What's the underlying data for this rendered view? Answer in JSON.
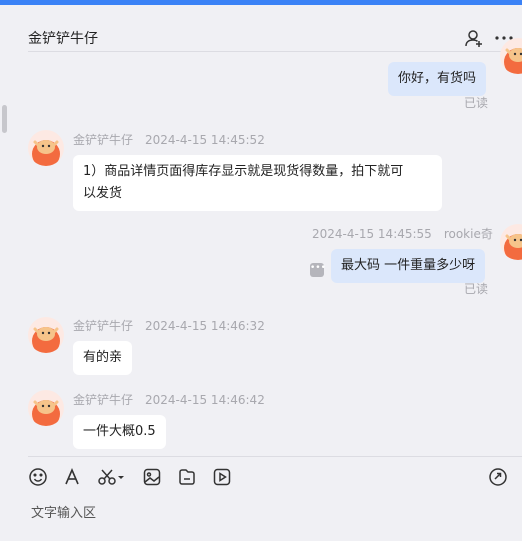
{
  "header": {
    "title": "金铲铲牛仔"
  },
  "messages": [
    {
      "side": "mine",
      "text": "你好，有货吗",
      "read": "已读"
    },
    {
      "side": "theirs",
      "sender": "金铲铲牛仔",
      "time": "2024-4-15 14:45:52",
      "text_line1": "1）商品详情页面得库存显示就是现货得数量，拍下就可",
      "text_line2": "以发货"
    },
    {
      "side": "mine",
      "sender": "rookie奇",
      "time": "2024-4-15 14:45:55",
      "text": "最大码 一件重量多少呀",
      "read": "已读"
    },
    {
      "side": "theirs",
      "sender": "金铲铲牛仔",
      "time": "2024-4-15 14:46:32",
      "text": "有的亲"
    },
    {
      "side": "theirs",
      "sender": "金铲铲牛仔",
      "time": "2024-4-15 14:46:42",
      "text": "一件大概0.5"
    }
  ],
  "composer": {
    "placeholder": "文字输入区"
  }
}
